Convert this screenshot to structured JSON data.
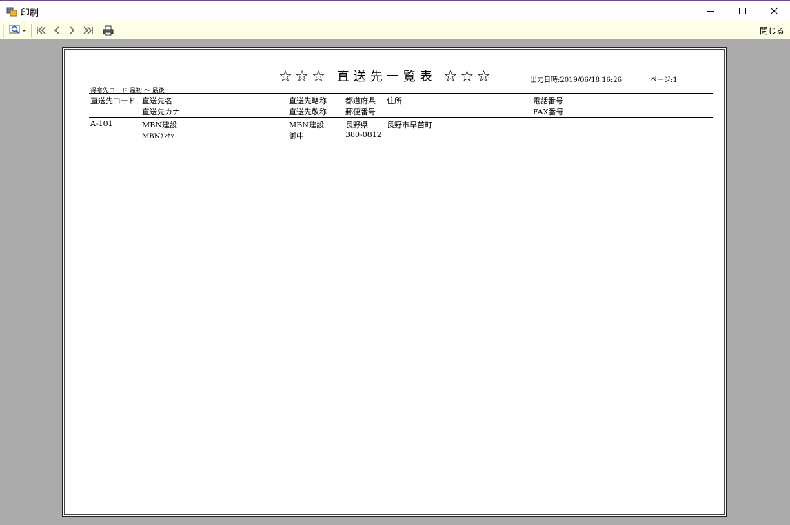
{
  "window": {
    "title": "印刷"
  },
  "toolbar": {
    "close_label": "閉じる"
  },
  "report": {
    "title": "☆☆☆ 直送先一覧表 ☆☆☆",
    "output_datetime": "出力日時:2019/06/18 16:26",
    "page": "ページ:1",
    "filter": "得意先コード:最初 ～ 最後",
    "headers": {
      "code": "直送先コード",
      "name": "直送先名",
      "kana": "直送先カナ",
      "short_name": "直送先略称",
      "honorific": "直送先敬称",
      "prefecture": "都道府県",
      "postal": "郵便番号",
      "address": "住所",
      "phone": "電話番号",
      "fax": "FAX番号"
    },
    "rows": [
      {
        "code": "A-101",
        "name": "MBN建設",
        "kana": "MBNｹﾝｾﾂ",
        "short_name": "MBN建設",
        "honorific": "御中",
        "prefecture": "長野県",
        "postal": "380-0812",
        "address": "長野市早苗町",
        "phone": "",
        "fax": ""
      }
    ]
  }
}
